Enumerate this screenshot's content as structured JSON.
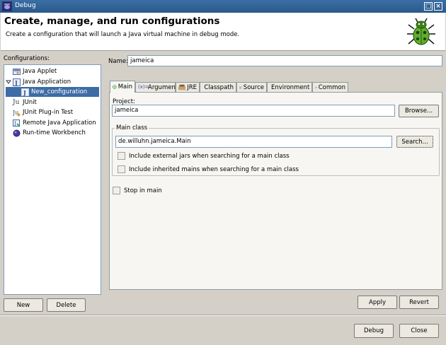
{
  "window": {
    "title": "Debug",
    "minmax_glyph": "□",
    "close_glyph": "×"
  },
  "header": {
    "title": "Create, manage, and run configurations",
    "subtitle": "Create a configuration that will launch a Java virtual machine in debug mode."
  },
  "configurations": {
    "label": "Configurations:",
    "items": [
      {
        "label": "Java Applet",
        "icon": "java-applet-icon"
      },
      {
        "label": "Java Application",
        "icon": "java-application-icon",
        "expanded": true
      },
      {
        "label": "New_configuration",
        "icon": "java-config-icon",
        "selected": true
      },
      {
        "label": "JUnit",
        "icon": "junit-icon"
      },
      {
        "label": "JUnit Plug-in Test",
        "icon": "junit-plugin-icon"
      },
      {
        "label": "Remote Java Application",
        "icon": "remote-java-icon"
      },
      {
        "label": "Run-time Workbench",
        "icon": "runtime-workbench-icon"
      }
    ],
    "new_label": "New",
    "delete_label": "Delete"
  },
  "name": {
    "label": "Name:",
    "value": "jameica"
  },
  "tabs": [
    {
      "label": "Main",
      "icon": "main-tab-icon",
      "active": true
    },
    {
      "label": "Arguments",
      "icon": "arguments-icon"
    },
    {
      "label": "JRE",
      "icon": "jre-icon"
    },
    {
      "label": "Classpath",
      "icon": "classpath-icon"
    },
    {
      "label": "Source",
      "icon": "source-icon"
    },
    {
      "label": "Environment",
      "icon": "environment-icon"
    },
    {
      "label": "Common",
      "icon": "common-icon"
    }
  ],
  "main_tab": {
    "project_label": "Project:",
    "project_value": "jameica",
    "browse_label": "Browse...",
    "main_class_label": "Main class",
    "main_class_value": "de.willuhn.jameica.Main",
    "search_label": "Search...",
    "include_external_jars": "Include external jars when searching for a main class",
    "include_inherited_mains": "Include inherited mains when searching for a main class",
    "stop_in_main": "Stop in main"
  },
  "actions": {
    "apply_label": "Apply",
    "revert_label": "Revert",
    "debug_label": "Debug",
    "close_label": "Close"
  }
}
